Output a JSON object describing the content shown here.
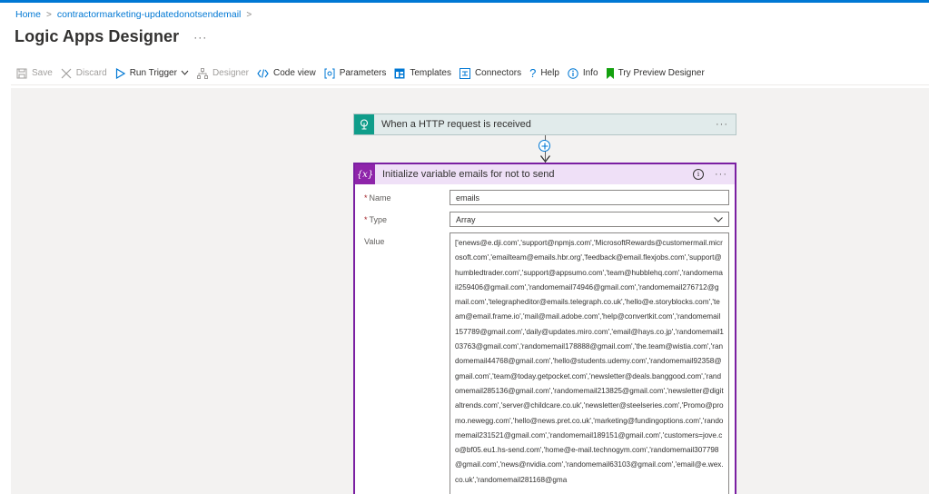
{
  "breadcrumb": {
    "home": "Home",
    "app": "contractormarketing-updatedonotsendemail"
  },
  "page": {
    "title": "Logic Apps Designer",
    "more": "···"
  },
  "toolbar": {
    "save": "Save",
    "discard": "Discard",
    "run_trigger": "Run Trigger",
    "designer": "Designer",
    "code_view": "Code view",
    "parameters": "Parameters",
    "templates": "Templates",
    "connectors": "Connectors",
    "help": "Help",
    "info": "Info",
    "try_preview": "Try Preview Designer"
  },
  "trigger": {
    "title": "When a HTTP request is received",
    "more": "···",
    "color": "#0f9d8a"
  },
  "action": {
    "icon_text": "{x}",
    "title": "Initialize variable emails for not to send",
    "more": "···",
    "color": "#8e24aa",
    "fields": {
      "name_label": "Name",
      "name_value": "emails",
      "type_label": "Type",
      "type_value": "Array",
      "value_label": "Value",
      "value_text": "['enews@e.dji.com','support@npmjs.com','MicrosoftRewards@customermail.microsoft.com','emailteam@emails.hbr.org','feedback@email.flexjobs.com','support@humbledtrader.com','support@appsumo.com','team@hubblehq.com','randomemail259406@gmail.com','randomemail74946@gmail.com','randomemail276712@gmail.com','telegrapheditor@emails.telegraph.co.uk','hello@e.storyblocks.com','team@email.frame.io','mail@mail.adobe.com','help@convertkit.com','randomemail157789@gmail.com','daily@updates.miro.com','email@hays.co.jp','randomemail103763@gmail.com','randomemail178888@gmail.com','the.team@wistia.com','randomemail44768@gmail.com','hello@students.udemy.com','randomemail92358@gmail.com','team@today.getpocket.com','newsletter@deals.banggood.com','randomemail285136@gmail.com','randomemail213825@gmail.com','newsletter@digitaltrends.com','server@childcare.co.uk','newsletter@steelseries.com','Promo@promo.newegg.com','hello@news.pret.co.uk','marketing@fundingoptions.com','randomemail231521@gmail.com','randomemail189151@gmail.com','customers=jove.co@bf05.eu1.hs-send.com','home@e-mail.technogym.com','randomemail307798@gmail.com','news@nvidia.com','randomemail63103@gmail.com','email@e.wex.co.uk','randomemail281168@gma"
    }
  },
  "colors": {
    "accent": "#0078d4",
    "canvas": "#f3f2f1",
    "action_border": "#7a1fa2"
  }
}
